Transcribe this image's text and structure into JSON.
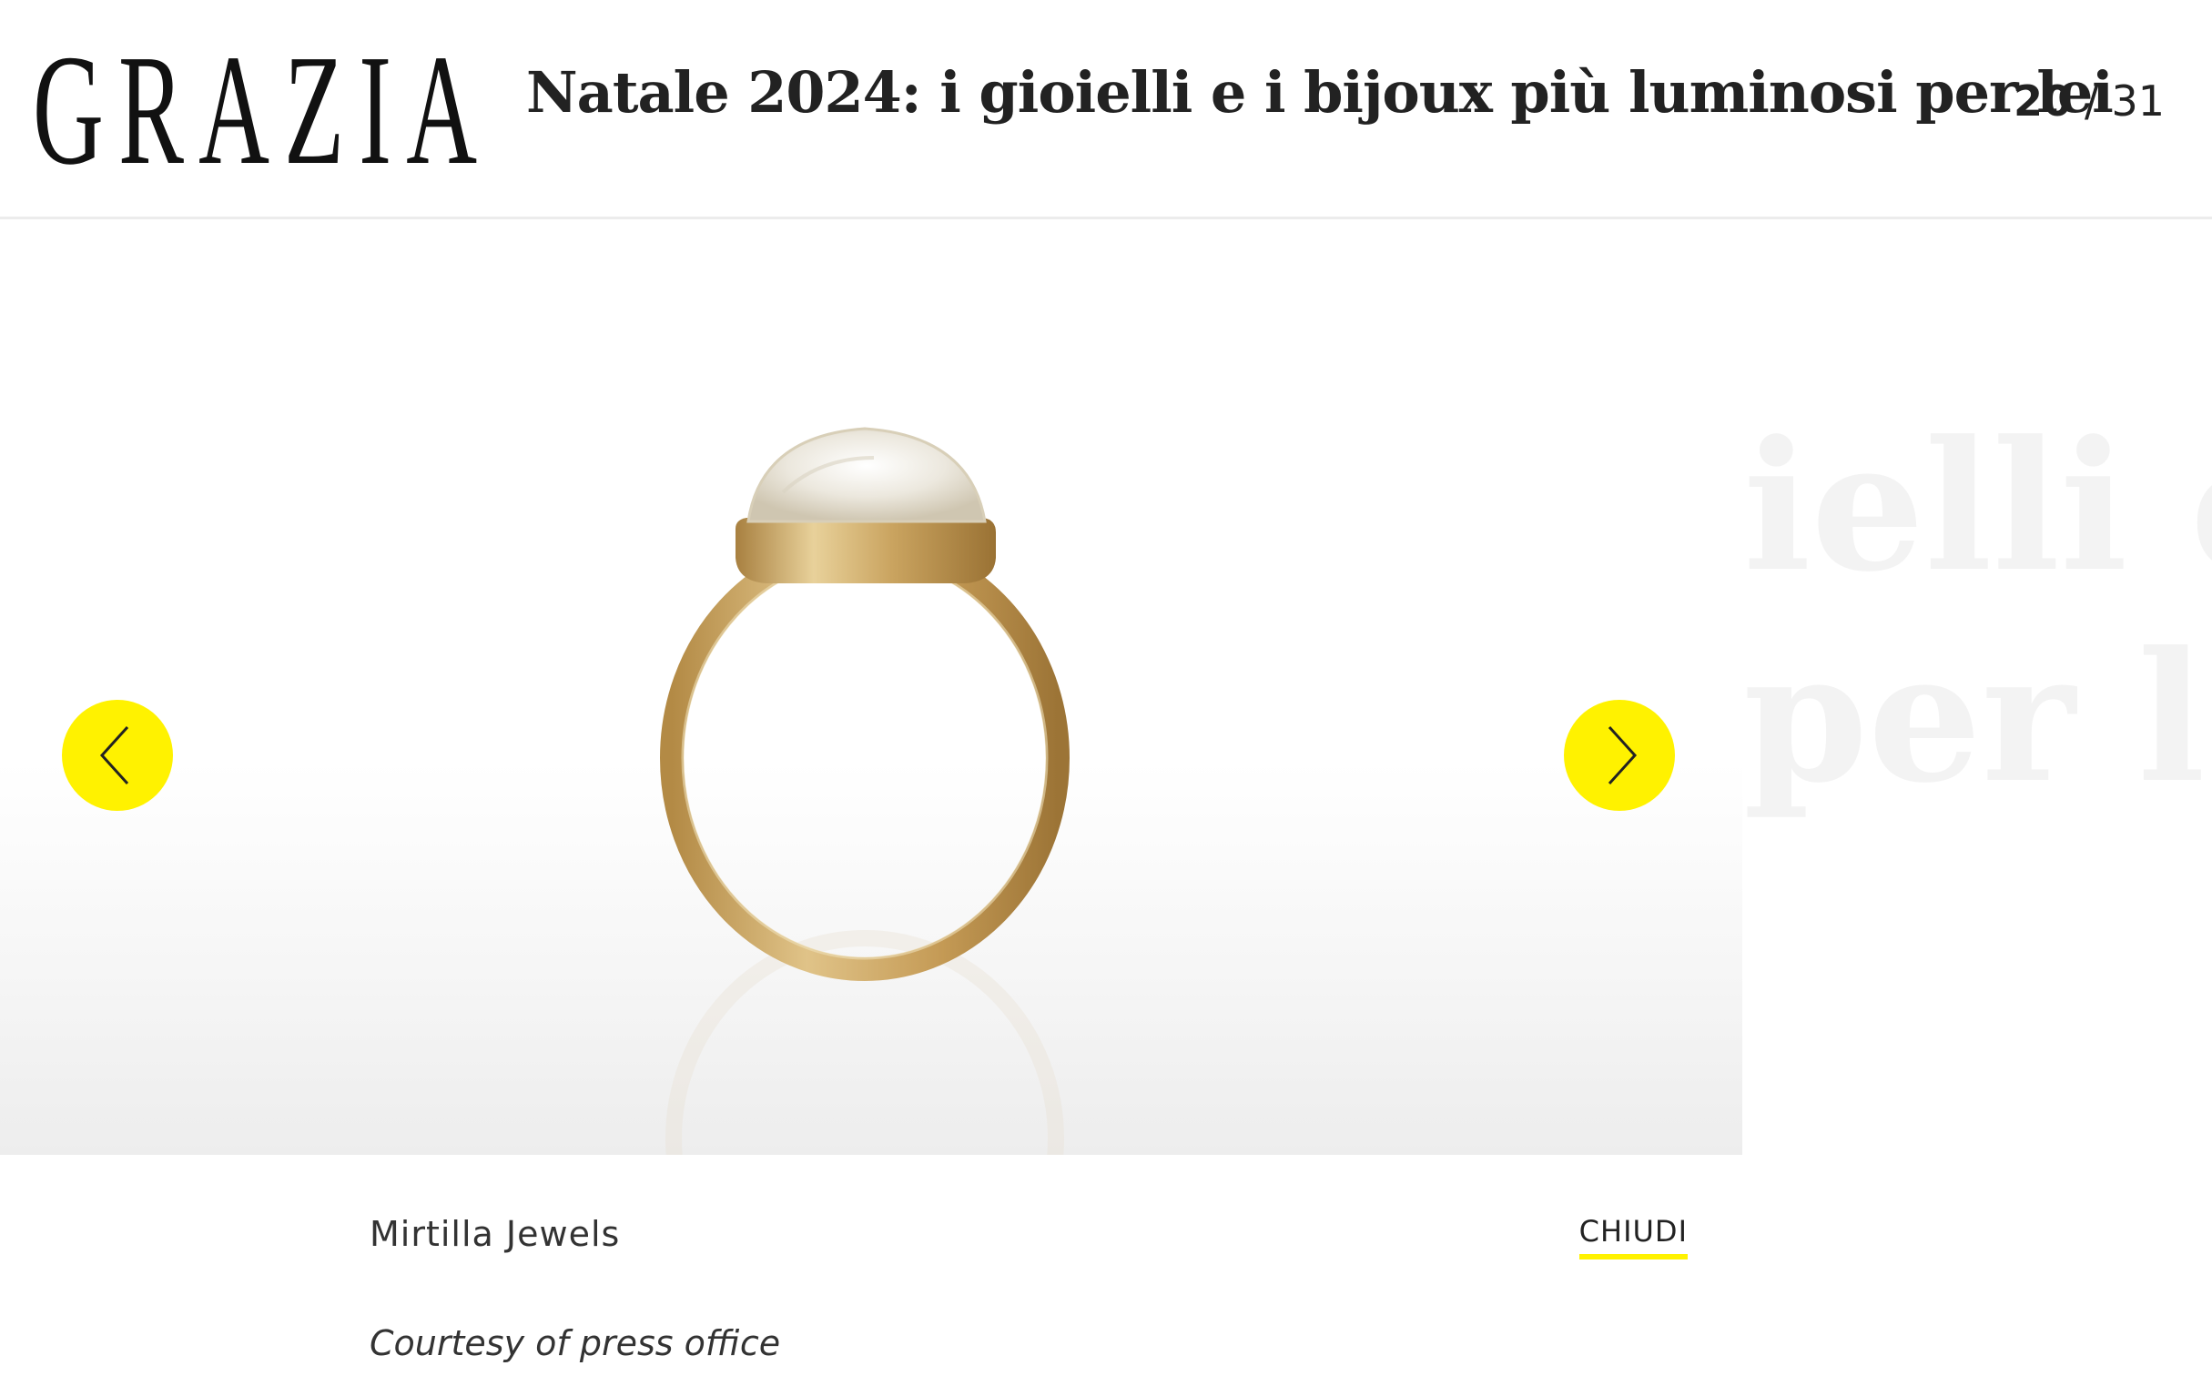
{
  "header": {
    "logo": "GRAZIA",
    "title": "Natale 2024: i gioielli e i bijoux più luminosi per lei",
    "counter": {
      "current": "20",
      "separator": "/",
      "total": "31"
    }
  },
  "gallery": {
    "background_text": [
      "ielli e",
      "per le"
    ],
    "image_subject": "gold ring with moonstone cabochon",
    "prev_icon": "chevron-left-icon",
    "next_icon": "chevron-right-icon"
  },
  "caption": {
    "name": "Mirtilla Jewels",
    "credit": "Courtesy of press office",
    "close_label": "CHIUDI"
  },
  "colors": {
    "accent": "#fff200",
    "text": "#222222",
    "divider": "#ececec",
    "ring_gold": "#c9a55e"
  }
}
